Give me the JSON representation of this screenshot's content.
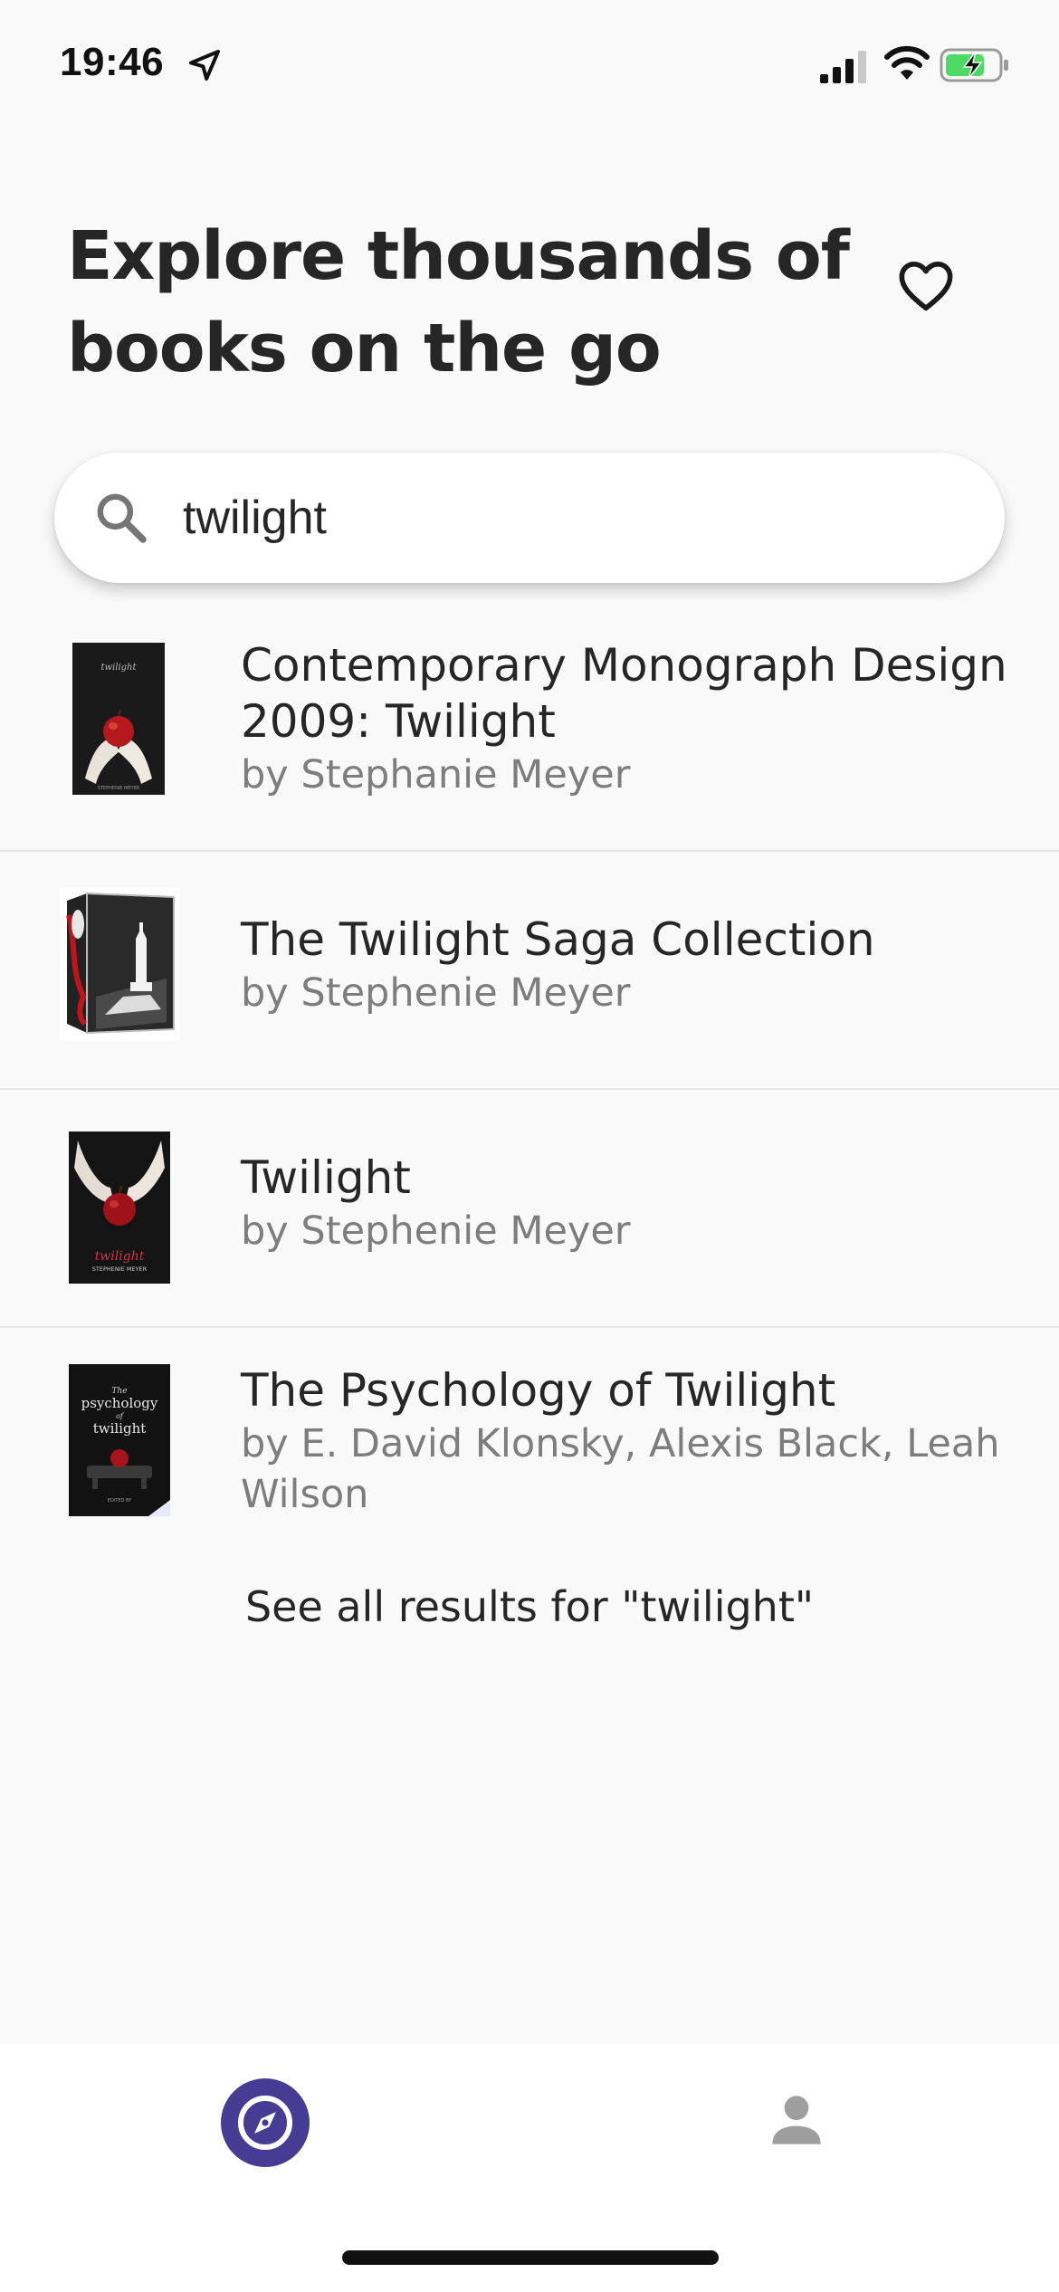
{
  "status_bar": {
    "time": "19:46",
    "icons": [
      "location-arrow-icon",
      "cellular-signal-icon",
      "wifi-icon",
      "battery-charging-icon"
    ],
    "battery_color": "#4cd964"
  },
  "header": {
    "title": "Explore thousands of books on the go",
    "favorites_icon": "heart-outline-icon"
  },
  "search": {
    "icon": "search-icon",
    "value": "twilight"
  },
  "results": [
    {
      "title": "Contemporary Monograph Design 2009: Twilight",
      "author": "by Stephanie Meyer",
      "cover": "apple-hands-cover"
    },
    {
      "title": "The Twilight Saga Collection",
      "author": "by Stephenie Meyer",
      "cover": "box-set-chess-cover"
    },
    {
      "title": "Twilight",
      "author": "by Stephenie Meyer",
      "cover": "apple-hands-cover"
    },
    {
      "title": "The Psychology of Twilight",
      "author": "by E. David Klonsky, Alexis Black, Leah Wilson",
      "cover": "psychology-twilight-cover"
    }
  ],
  "see_all_label": "See all results for \"twilight\"",
  "bottom_nav": {
    "items": [
      {
        "name": "explore",
        "icon": "compass-icon",
        "active": true
      },
      {
        "name": "profile",
        "icon": "person-icon",
        "active": false
      }
    ],
    "accent_color": "#463c93"
  }
}
